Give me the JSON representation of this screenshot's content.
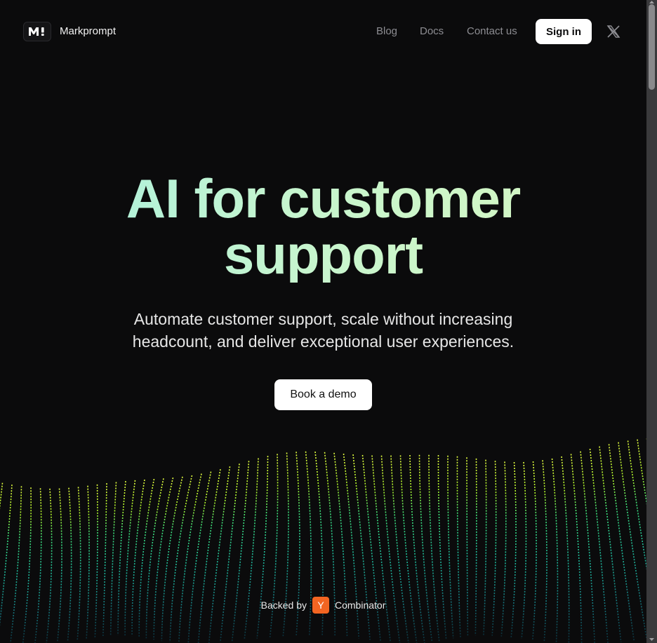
{
  "nav": {
    "brand": "Markprompt",
    "links": [
      "Blog",
      "Docs",
      "Contact us"
    ],
    "sign_in": "Sign in"
  },
  "hero": {
    "title_line1": "AI for customer",
    "title_line2": "support",
    "subtitle_line1": "Automate customer support, scale without increasing",
    "subtitle_line2": "headcount, and deliver exceptional user experiences.",
    "cta": "Book a demo"
  },
  "backed": {
    "prefix": "Backed by",
    "badge": "Y",
    "suffix": "Combinator"
  },
  "colors": {
    "background": "#0b0b0c",
    "accent_lime": "#d4ff3a",
    "accent_teal": "#1fb89a",
    "yc_orange": "#f26522"
  }
}
